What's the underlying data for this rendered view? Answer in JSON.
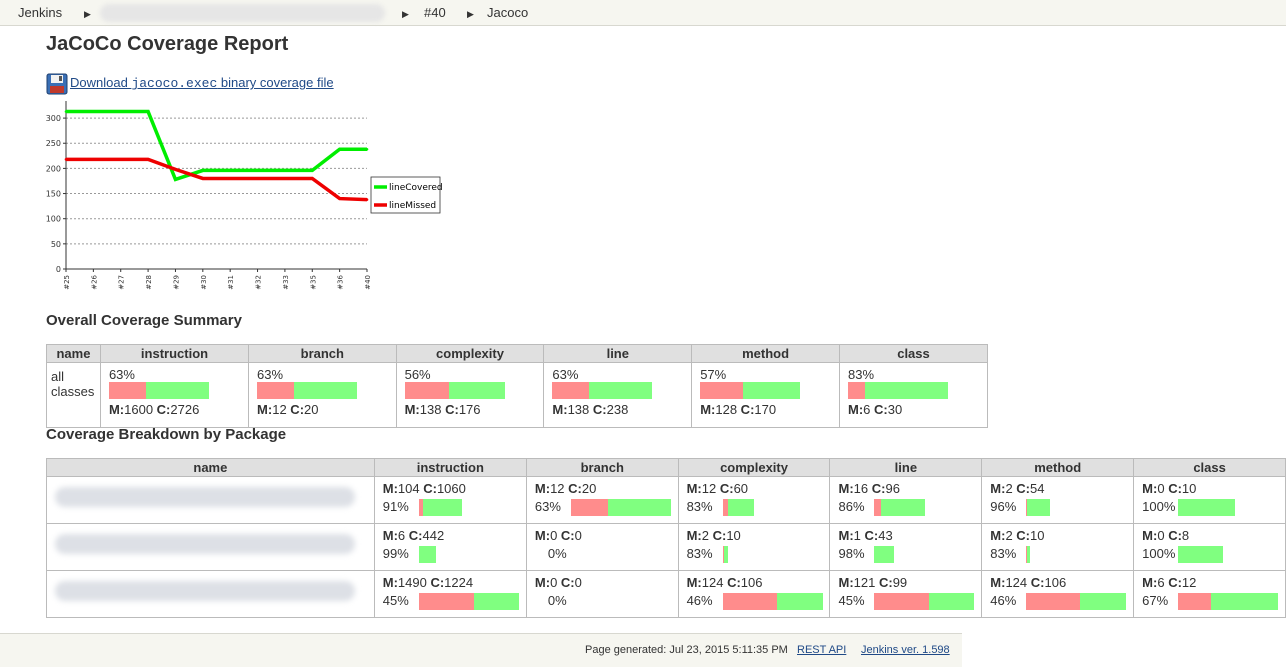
{
  "breadcrumb": {
    "items": [
      "Jenkins",
      "#40",
      "Jacoco"
    ]
  },
  "page_title": "JaCoCo Coverage Report",
  "download": {
    "prefix": "Download ",
    "code": "jacoco.exec",
    "suffix": " binary coverage file"
  },
  "chart_data": {
    "type": "line",
    "categories": [
      "#25",
      "#26",
      "#27",
      "#28",
      "#29",
      "#30",
      "#31",
      "#32",
      "#33",
      "#35",
      "#36",
      "#40"
    ],
    "series": [
      {
        "name": "lineCovered",
        "color": "#00ee00",
        "values": [
          313,
          313,
          313,
          313,
          178,
          196,
          196,
          196,
          196,
          196,
          238,
          238
        ]
      },
      {
        "name": "lineMissed",
        "color": "#ee0000",
        "values": [
          218,
          218,
          218,
          218,
          198,
          180,
          180,
          180,
          180,
          180,
          140,
          138
        ]
      }
    ],
    "yticks": [
      0,
      50,
      100,
      150,
      200,
      250,
      300
    ],
    "ylim": [
      0,
      330
    ],
    "grid": true,
    "legend": "right"
  },
  "summary": {
    "title": "Overall Coverage Summary",
    "headers": [
      "name",
      "instruction",
      "branch",
      "complexity",
      "line",
      "method",
      "class"
    ],
    "row_name_1": "all",
    "row_name_2": "classes",
    "cells": [
      {
        "pct": "63%",
        "ratio": 0.37,
        "m": "1600",
        "c": "2726"
      },
      {
        "pct": "63%",
        "ratio": 0.37,
        "m": "12",
        "c": "20"
      },
      {
        "pct": "56%",
        "ratio": 0.44,
        "m": "138",
        "c": "176"
      },
      {
        "pct": "63%",
        "ratio": 0.37,
        "m": "138",
        "c": "238"
      },
      {
        "pct": "57%",
        "ratio": 0.43,
        "m": "128",
        "c": "170"
      },
      {
        "pct": "83%",
        "ratio": 0.17,
        "m": "6",
        "c": "30"
      }
    ]
  },
  "breakdown": {
    "title": "Coverage Breakdown by Package",
    "headers": [
      "name",
      "instruction",
      "branch",
      "complexity",
      "line",
      "method",
      "class"
    ],
    "rows": [
      {
        "cells": [
          {
            "m": "104",
            "c": "1060",
            "pct": "91%",
            "red": 0.04,
            "green": 0.39
          },
          {
            "m": "12",
            "c": "20",
            "pct": "63%",
            "red": 0.37,
            "green": 0.63
          },
          {
            "m": "12",
            "c": "60",
            "pct": "83%",
            "red": 0.05,
            "green": 0.26
          },
          {
            "m": "16",
            "c": "96",
            "pct": "86%",
            "red": 0.07,
            "green": 0.44
          },
          {
            "m": "2",
            "c": "54",
            "pct": "96%",
            "red": 0.01,
            "green": 0.23
          },
          {
            "m": "0",
            "c": "10",
            "pct": "100%",
            "red": 0,
            "green": 0.57
          }
        ]
      },
      {
        "cells": [
          {
            "m": "6",
            "c": "442",
            "pct": "99%",
            "red": 0,
            "green": 0.17
          },
          {
            "m": "0",
            "c": "0",
            "pct": "0%",
            "red": 0,
            "green": 0
          },
          {
            "m": "2",
            "c": "10",
            "pct": "83%",
            "red": 0.01,
            "green": 0.04
          },
          {
            "m": "1",
            "c": "43",
            "pct": "98%",
            "red": 0,
            "green": 0.2
          },
          {
            "m": "2",
            "c": "10",
            "pct": "83%",
            "red": 0.01,
            "green": 0.03
          },
          {
            "m": "0",
            "c": "8",
            "pct": "100%",
            "red": 0,
            "green": 0.45
          }
        ]
      },
      {
        "cells": [
          {
            "m": "1490",
            "c": "1224",
            "pct": "45%",
            "red": 0.55,
            "green": 0.45
          },
          {
            "m": "0",
            "c": "0",
            "pct": "0%",
            "red": 0,
            "green": 0
          },
          {
            "m": "124",
            "c": "106",
            "pct": "46%",
            "red": 0.54,
            "green": 0.46
          },
          {
            "m": "121",
            "c": "99",
            "pct": "45%",
            "red": 0.55,
            "green": 0.45
          },
          {
            "m": "124",
            "c": "106",
            "pct": "46%",
            "red": 0.54,
            "green": 0.46
          },
          {
            "m": "6",
            "c": "12",
            "pct": "67%",
            "red": 0.33,
            "green": 0.67
          }
        ]
      }
    ]
  },
  "footer": {
    "generated": "Page generated: Jul 23, 2015 5:11:35 PM",
    "rest_api": "REST API",
    "version": "Jenkins ver. 1.598"
  }
}
